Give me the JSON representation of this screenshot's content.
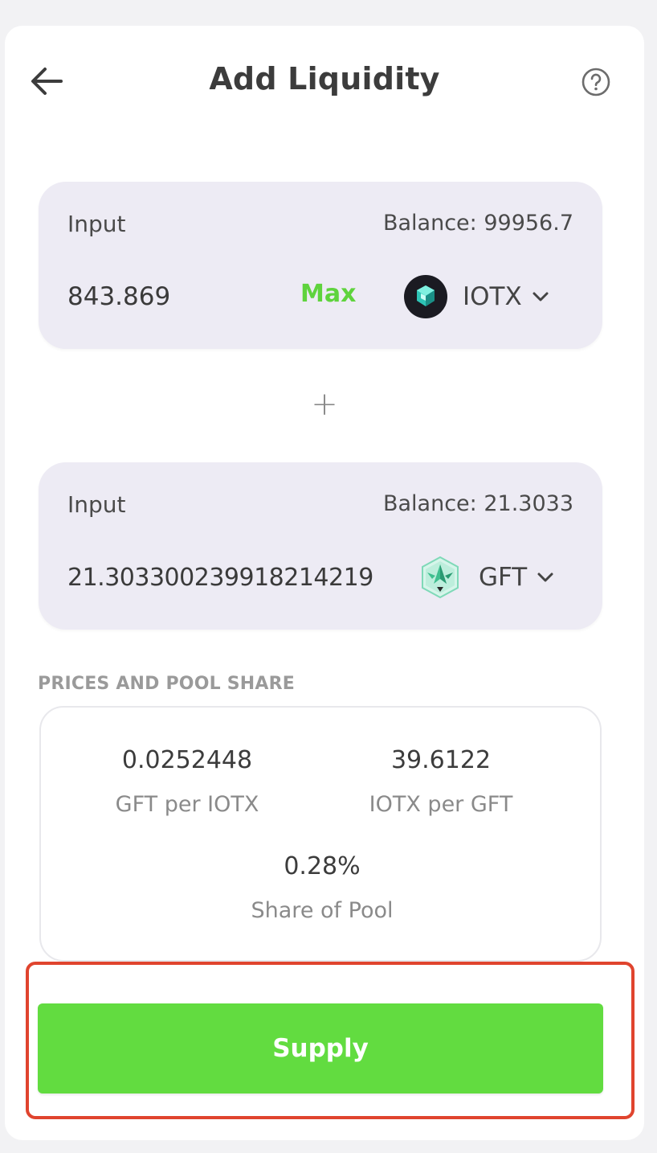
{
  "header": {
    "title": "Add Liquidity",
    "back_icon": "arrow-left-icon",
    "help_icon": "question-circle-icon"
  },
  "token_a": {
    "label": "Input",
    "balance": "Balance: 99956.7",
    "amount": "843.869",
    "max_label": "Max",
    "symbol": "IOTX",
    "logo_icon": "iotx-logo-icon"
  },
  "plus": "+",
  "token_b": {
    "label": "Input",
    "balance": "Balance: 21.3033",
    "amount": "21.303300239918214219",
    "symbol": "GFT",
    "logo_icon": "gft-logo-icon"
  },
  "pool": {
    "section_title": "PRICES AND POOL SHARE",
    "rate1_value": "0.0252448",
    "rate1_label": "GFT per IOTX",
    "rate2_value": "39.6122",
    "rate2_label": "IOTX per GFT",
    "share_value": "0.28%",
    "share_label": "Share of Pool"
  },
  "supply_button": "Supply",
  "colors": {
    "accent_green": "#62dc40",
    "max_green": "#5fd33d",
    "highlight_red": "#e0442e",
    "input_bg": "#edebf4"
  }
}
